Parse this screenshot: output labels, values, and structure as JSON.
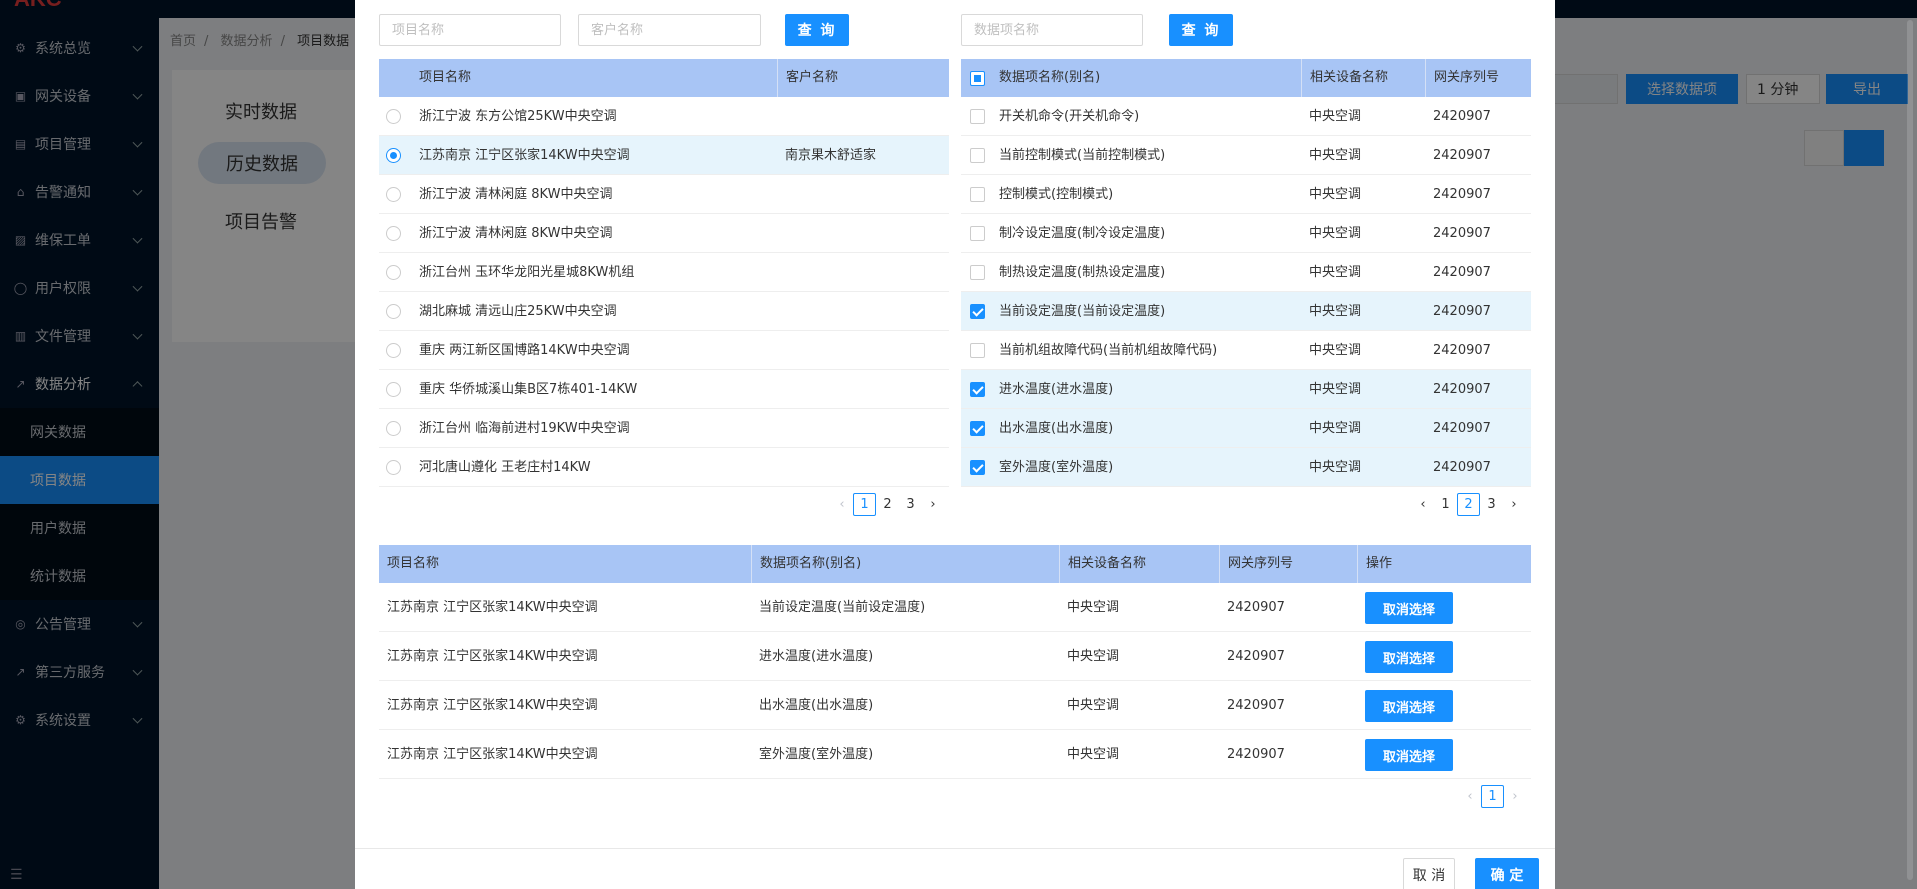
{
  "app": {
    "logo": "AKC"
  },
  "sidebar": {
    "items": [
      {
        "label": "系统总览",
        "icon": "dashboard-icon"
      },
      {
        "label": "网关设备",
        "icon": "gateway-icon"
      },
      {
        "label": "项目管理",
        "icon": "project-icon"
      },
      {
        "label": "告警通知",
        "icon": "alarm-icon"
      },
      {
        "label": "维保工单",
        "icon": "workorder-icon"
      },
      {
        "label": "用户权限",
        "icon": "user-icon"
      },
      {
        "label": "文件管理",
        "icon": "file-icon"
      },
      {
        "label": "数据分析",
        "icon": "chart-icon"
      }
    ],
    "sub_items": [
      "网关数据",
      "项目数据",
      "用户数据",
      "统计数据"
    ],
    "items_after": [
      {
        "label": "公告管理",
        "icon": "notice-icon"
      },
      {
        "label": "第三方服务",
        "icon": "third-party-icon"
      },
      {
        "label": "系统设置",
        "icon": "settings-icon"
      }
    ]
  },
  "breadcrumb": [
    "首页",
    "数据分析",
    "项目数据"
  ],
  "side_tabs": [
    "实时数据",
    "历史数据",
    "项目告警"
  ],
  "toolbar": {
    "select_items": "选择数据项",
    "interval": "1 分钟",
    "export": "导出"
  },
  "modal": {
    "left_search": {
      "project_placeholder": "项目名称",
      "customer_placeholder": "客户名称",
      "query": "查 询"
    },
    "right_search": {
      "item_placeholder": "数据项名称",
      "query": "查 询"
    },
    "projects": {
      "headers": [
        "项目名称",
        "客户名称"
      ],
      "rows": [
        {
          "name": "浙江宁波 东方公馆25KW中央空调",
          "customer": "",
          "selected": false
        },
        {
          "name": "江苏南京 江宁区张家14KW中央空调",
          "customer": "南京果木舒适家",
          "selected": true
        },
        {
          "name": "浙江宁波 清林闲庭 8KW中央空调",
          "customer": "",
          "selected": false
        },
        {
          "name": "浙江宁波 清林闲庭 8KW中央空调",
          "customer": "",
          "selected": false
        },
        {
          "name": "浙江台州 玉环华龙阳光星城8KW机组",
          "customer": "",
          "selected": false
        },
        {
          "name": "湖北麻城 清远山庄25KW中央空调",
          "customer": "",
          "selected": false
        },
        {
          "name": "重庆 两江新区国博路14KW中央空调",
          "customer": "",
          "selected": false
        },
        {
          "name": "重庆 华侨城溪山集B区7栋401-14KW",
          "customer": "",
          "selected": false
        },
        {
          "name": "浙江台州 临海前进村19KW中央空调",
          "customer": "",
          "selected": false
        },
        {
          "name": "河北唐山遵化 王老庄村14KW",
          "customer": "",
          "selected": false
        }
      ],
      "pages": [
        "1",
        "2",
        "3"
      ],
      "current_page": "1"
    },
    "items": {
      "headers": [
        "数据项名称(别名)",
        "相关设备名称",
        "网关序列号"
      ],
      "rows": [
        {
          "name": "开关机命令(开关机命令)",
          "device": "中央空调",
          "serial": "2420907",
          "checked": false
        },
        {
          "name": "当前控制模式(当前控制模式)",
          "device": "中央空调",
          "serial": "2420907",
          "checked": false
        },
        {
          "name": "控制模式(控制模式)",
          "device": "中央空调",
          "serial": "2420907",
          "checked": false
        },
        {
          "name": "制冷设定温度(制冷设定温度)",
          "device": "中央空调",
          "serial": "2420907",
          "checked": false
        },
        {
          "name": "制热设定温度(制热设定温度)",
          "device": "中央空调",
          "serial": "2420907",
          "checked": false
        },
        {
          "name": "当前设定温度(当前设定温度)",
          "device": "中央空调",
          "serial": "2420907",
          "checked": true
        },
        {
          "name": "当前机组故障代码(当前机组故障代码)",
          "device": "中央空调",
          "serial": "2420907",
          "checked": false
        },
        {
          "name": "进水温度(进水温度)",
          "device": "中央空调",
          "serial": "2420907",
          "checked": true
        },
        {
          "name": "出水温度(出水温度)",
          "device": "中央空调",
          "serial": "2420907",
          "checked": true
        },
        {
          "name": "室外温度(室外温度)",
          "device": "中央空调",
          "serial": "2420907",
          "checked": true
        }
      ],
      "pages": [
        "1",
        "2",
        "3"
      ],
      "current_page": "2"
    },
    "selected": {
      "headers": [
        "项目名称",
        "数据项名称(别名)",
        "相关设备名称",
        "网关序列号",
        "操作"
      ],
      "rows": [
        {
          "project": "江苏南京 江宁区张家14KW中央空调",
          "item": "当前设定温度(当前设定温度)",
          "device": "中央空调",
          "serial": "2420907",
          "action": "取消选择"
        },
        {
          "project": "江苏南京 江宁区张家14KW中央空调",
          "item": "进水温度(进水温度)",
          "device": "中央空调",
          "serial": "2420907",
          "action": "取消选择"
        },
        {
          "project": "江苏南京 江宁区张家14KW中央空调",
          "item": "出水温度(出水温度)",
          "device": "中央空调",
          "serial": "2420907",
          "action": "取消选择"
        },
        {
          "project": "江苏南京 江宁区张家14KW中央空调",
          "item": "室外温度(室外温度)",
          "device": "中央空调",
          "serial": "2420907",
          "action": "取消选择"
        }
      ],
      "pages": [
        "1"
      ],
      "current_page": "1"
    },
    "footer": {
      "cancel": "取 消",
      "ok": "确 定"
    }
  }
}
